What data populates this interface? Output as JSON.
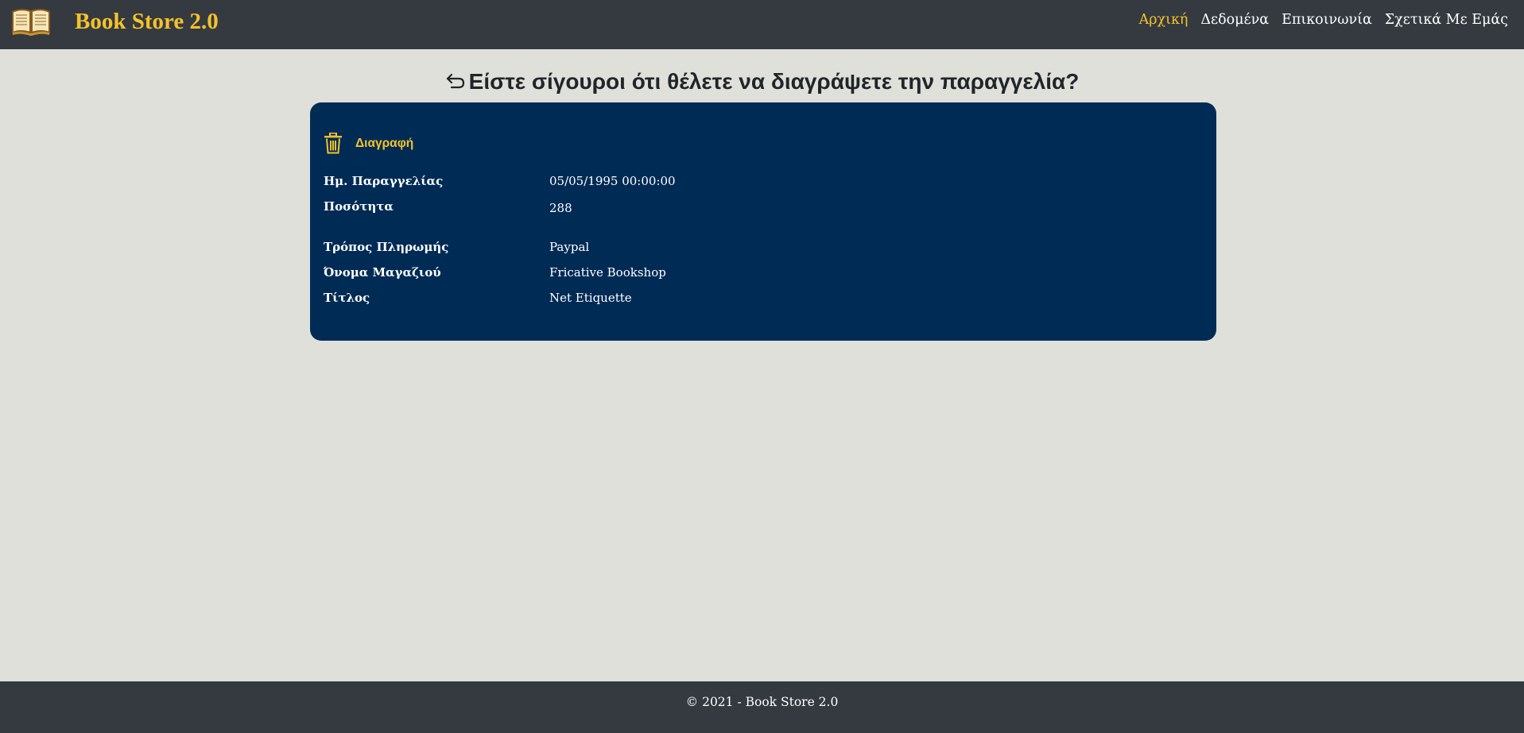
{
  "brand": {
    "title": "Book Store 2.0",
    "logo_icon": "open-book-icon"
  },
  "nav": {
    "items": [
      {
        "label": "Αρχική",
        "active": true
      },
      {
        "label": "Δεδομένα",
        "active": false
      },
      {
        "label": "Επικοινωνία",
        "active": false
      },
      {
        "label": "Σχετικά Με Εμάς",
        "active": false
      }
    ]
  },
  "page": {
    "heading": "Είστε σίγουροι ότι θέλετε να διαγράψετε την παραγγελία?",
    "back_icon": "back-arrow-icon"
  },
  "card": {
    "delete_label": "Διαγραφή",
    "delete_icon": "trash-icon",
    "fields": [
      {
        "label": "Ημ. Παραγγελίας",
        "value": "05/05/1995 00:00:00"
      },
      {
        "label": "Ποσότητα",
        "value": "288"
      },
      {
        "label": "Τρόπος Πληρωμής",
        "value": "Paypal"
      },
      {
        "label": "Όνομα Μαγαζιού",
        "value": "Fricative Bookshop"
      },
      {
        "label": "Τίτλος",
        "value": "Net Etiquette"
      }
    ]
  },
  "footer": {
    "text": "© 2021 - Book Store 2.0"
  },
  "colors": {
    "navbar": "#343a40",
    "accent": "#f5c22b",
    "card": "#002b55",
    "page_bg": "#dfe0da"
  }
}
